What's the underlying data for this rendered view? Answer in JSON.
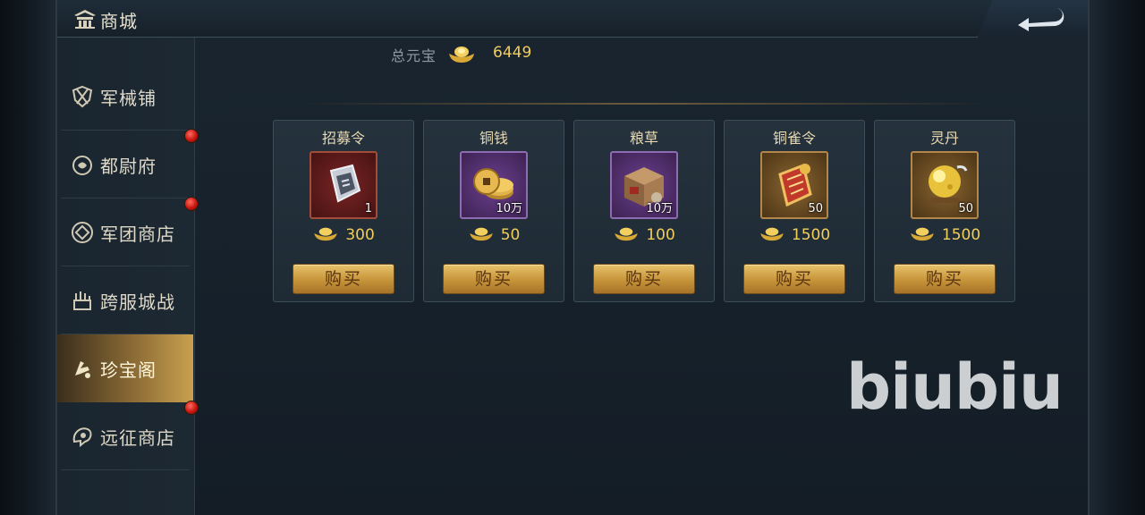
{
  "header": {
    "title": "商城"
  },
  "sidebar": {
    "items": [
      {
        "label": "军械铺",
        "icon": "armory-icon",
        "badge": false,
        "active": false
      },
      {
        "label": "都尉府",
        "icon": "commandant-icon",
        "badge": true,
        "active": false
      },
      {
        "label": "军团商店",
        "icon": "legion-shop-icon",
        "badge": true,
        "active": false
      },
      {
        "label": "跨服城战",
        "icon": "cross-server-battle-icon",
        "badge": false,
        "active": false
      },
      {
        "label": "珍宝阁",
        "icon": "treasure-pavilion-icon",
        "badge": false,
        "active": true
      },
      {
        "label": "远征商店",
        "icon": "expedition-shop-icon",
        "badge": true,
        "active": false
      }
    ]
  },
  "total": {
    "label": "总元宝",
    "value": "6449",
    "icon": "gold-ingot-icon"
  },
  "shop_items": [
    {
      "name": "招募令",
      "qty": "1",
      "price": "300",
      "icon": "recruit-token-icon",
      "rarity": "red",
      "buy_label": "购买"
    },
    {
      "name": "铜钱",
      "qty": "10万",
      "price": "50",
      "icon": "copper-coins-icon",
      "rarity": "purple",
      "buy_label": "购买"
    },
    {
      "name": "粮草",
      "qty": "10万",
      "price": "100",
      "icon": "provisions-crate-icon",
      "rarity": "purple",
      "buy_label": "购买"
    },
    {
      "name": "铜雀令",
      "qty": "50",
      "price": "1500",
      "icon": "bronze-sparrow-token-icon",
      "rarity": "gold",
      "buy_label": "购买"
    },
    {
      "name": "灵丹",
      "qty": "50",
      "price": "1500",
      "icon": "elixir-orb-icon",
      "rarity": "gold",
      "buy_label": "购买"
    }
  ],
  "watermark": "biubiu",
  "colors": {
    "gold_text": "#f1cd5a",
    "button_gold": "#c9973c",
    "badge_red": "#c8160f"
  }
}
